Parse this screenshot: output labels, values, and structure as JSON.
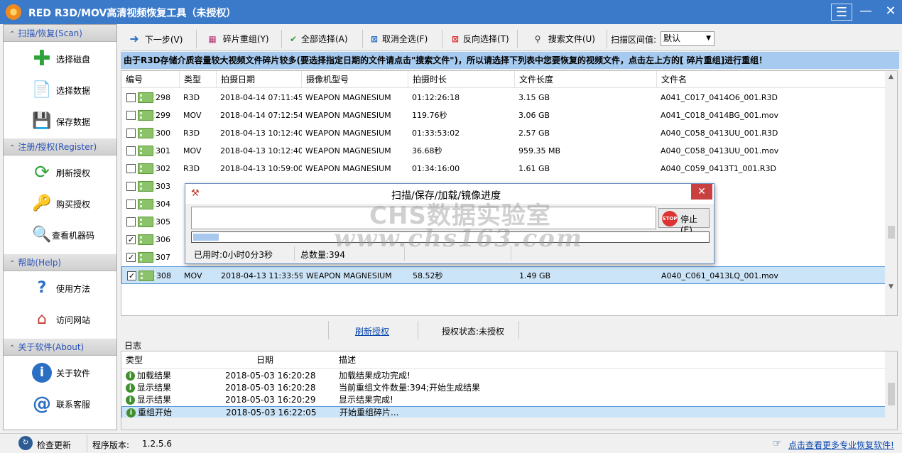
{
  "window": {
    "title": "RED R3D/MOV高清视频恢复工具（未授权）"
  },
  "sidebar": {
    "sections": [
      {
        "header": "扫描/恢复(Scan)",
        "items": [
          {
            "label": "选择磁盘",
            "icon": "plus-icon"
          },
          {
            "label": "选择数据",
            "icon": "document-icon"
          },
          {
            "label": "保存数据",
            "icon": "floppy-icon"
          }
        ]
      },
      {
        "header": "注册/授权(Register)",
        "items": [
          {
            "label": "刷新授权",
            "icon": "refresh-icon"
          },
          {
            "label": "购买授权",
            "icon": "key-icon"
          },
          {
            "label": "查看机器码",
            "icon": "machine-icon"
          }
        ]
      },
      {
        "header": "帮助(Help)",
        "items": [
          {
            "label": "使用方法",
            "icon": "help-book-icon"
          },
          {
            "label": "访问网站",
            "icon": "home-globe-icon"
          }
        ]
      },
      {
        "header": "关于软件(About)",
        "items": [
          {
            "label": "关于软件",
            "icon": "info-icon"
          },
          {
            "label": "联系客服",
            "icon": "email-icon"
          }
        ]
      }
    ]
  },
  "toolbar": {
    "next": "下一步(V)",
    "reassemble": "碎片重组(Y)",
    "select_all": "全部选择(A)",
    "deselect_all": "取消全选(F)",
    "invert": "反向选择(T)",
    "search": "搜索文件(U)",
    "scan_interval_label": "扫描区间值:",
    "scan_interval_value": "默认"
  },
  "infobar": {
    "text": "由于R3D存储介质容量较大视频文件碎片较多(要选择指定日期的文件请点击\"搜索文件\")，所以请选择下列表中您要恢复的视频文件，点击左上方的[ 碎片重组]进行重组！"
  },
  "file_table": {
    "columns": [
      "编号",
      "类型",
      "拍摄日期",
      "摄像机型号",
      "拍摄时长",
      "文件长度",
      "文件名"
    ],
    "rows": [
      {
        "checked": false,
        "id": "298",
        "type": "R3D",
        "date": "2018-04-14 07:11:45",
        "camera": "WEAPON MAGNESIUM",
        "duration": "01:12:26:18",
        "size": "3.15 GB",
        "name": "A041_C017_0414O6_001.R3D",
        "selected": false
      },
      {
        "checked": false,
        "id": "299",
        "type": "MOV",
        "date": "2018-04-14 07:12:54",
        "camera": "WEAPON MAGNESIUM",
        "duration": "119.76秒",
        "size": "3.06 GB",
        "name": "A041_C018_0414BG_001.mov",
        "selected": false
      },
      {
        "checked": false,
        "id": "300",
        "type": "R3D",
        "date": "2018-04-13 10:12:40",
        "camera": "WEAPON MAGNESIUM",
        "duration": "01:33:53:02",
        "size": "2.57 GB",
        "name": "A040_C058_0413UU_001.R3D",
        "selected": false
      },
      {
        "checked": false,
        "id": "301",
        "type": "MOV",
        "date": "2018-04-13 10:12:40",
        "camera": "WEAPON MAGNESIUM",
        "duration": "36.68秒",
        "size": "959.35 MB",
        "name": "A040_C058_0413UU_001.mov",
        "selected": false
      },
      {
        "checked": false,
        "id": "302",
        "type": "R3D",
        "date": "2018-04-13 10:59:00",
        "camera": "WEAPON MAGNESIUM",
        "duration": "01:34:16:00",
        "size": "1.61 GB",
        "name": "A040_C059_0413T1_001.R3D",
        "selected": false
      },
      {
        "checked": false,
        "id": "303",
        "type": "",
        "date": "",
        "camera": "",
        "duration": "",
        "size": "",
        "name": "3T1_001.mov",
        "selected": false
      },
      {
        "checked": false,
        "id": "304",
        "type": "",
        "date": "",
        "camera": "",
        "duration": "",
        "size": "",
        "name": "3RS_001.R3D",
        "selected": false
      },
      {
        "checked": false,
        "id": "305",
        "type": "",
        "date": "",
        "camera": "",
        "duration": "",
        "size": "",
        "name": "3RS_001.mov",
        "selected": false
      },
      {
        "checked": true,
        "id": "306",
        "type": "",
        "date": "",
        "camera": "",
        "duration": "",
        "size": "",
        "name": "3LQ_001.R3D",
        "selected": false
      },
      {
        "checked": true,
        "id": "307",
        "type": "",
        "date": "",
        "camera": "",
        "duration": "",
        "size": "",
        "name": "3LQ_002.R3D",
        "selected": false
      },
      {
        "checked": true,
        "id": "308",
        "type": "MOV",
        "date": "2018-04-13 11:33:59",
        "camera": "WEAPON MAGNESIUM",
        "duration": "58.52秒",
        "size": "1.49 GB",
        "name": "A040_C061_0413LQ_001.mov",
        "selected": true
      }
    ]
  },
  "midbar": {
    "refresh_link": "刷新授权",
    "license_status": "授权状态:未授权"
  },
  "log": {
    "title": "日志",
    "columns": [
      "类型",
      "日期",
      "描述"
    ],
    "rows": [
      {
        "type": "加载结果",
        "date": "2018-05-03 16:20:28",
        "desc": "加载结果成功完成!",
        "selected": false
      },
      {
        "type": "显示结果",
        "date": "2018-05-03 16:20:28",
        "desc": "当前重组文件数量:394;开始生成结果",
        "selected": false
      },
      {
        "type": "显示结果",
        "date": "2018-05-03 16:20:29",
        "desc": "显示结果完成!",
        "selected": false
      },
      {
        "type": "重组开始",
        "date": "2018-05-03 16:22:05",
        "desc": "开始重组碎片...",
        "selected": true
      }
    ]
  },
  "statusbar": {
    "check_update": "检查更新",
    "version_label": "程序版本:",
    "version": "1.2.5.6",
    "more_link": "点击查看更多专业恢复软件!"
  },
  "progress_dialog": {
    "title": "扫描/保存/加载/镜像进度",
    "stop_label": "停止(E)",
    "progress_fraction": 0.05,
    "elapsed": "已用时:0小时0分3秒",
    "total": "总数量:394"
  },
  "watermark": {
    "line1": "CHS数据实验室",
    "line2": "www.chs163.com"
  },
  "colors": {
    "titlebar": "#3b7ac9",
    "infobar": "#a7cbf0",
    "selected_row": "#cce4f7",
    "link": "#0645ad"
  }
}
